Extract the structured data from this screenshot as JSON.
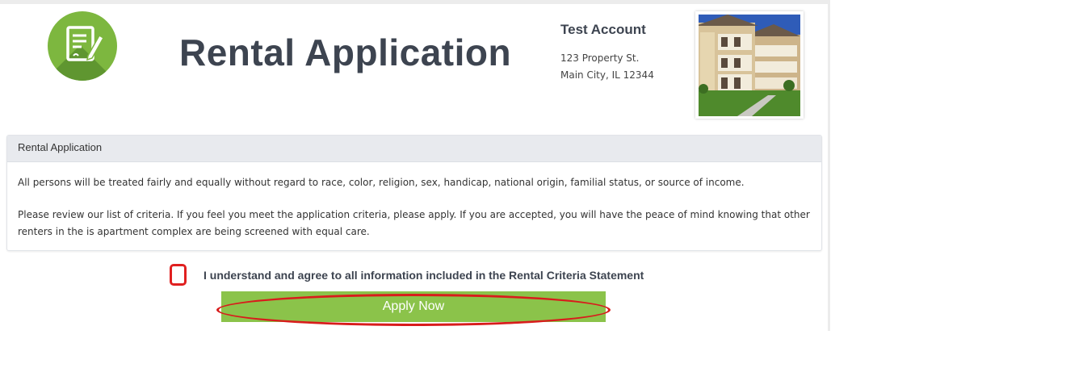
{
  "header": {
    "logo_icon": "application-form-icon",
    "title": "Rental Application"
  },
  "account": {
    "name": "Test Account",
    "address_line1": "123 Property St.",
    "address_line2": "Main City, IL 12344"
  },
  "property_photo": {
    "icon": "apartment-building-photo"
  },
  "panel": {
    "heading": "Rental Application",
    "paragraph1": "All persons will be treated fairly and equally without regard to race, color, religion, sex, handicap, national origin, familial status, or source of income.",
    "paragraph2": "Please review our list of criteria. If you feel you meet the application criteria, please apply. If you are accepted, you will have the peace of mind knowing that other renters in the is apartment complex are being screened with equal care."
  },
  "agreement": {
    "label": "I understand and agree to all information included in the Rental Criteria Statement",
    "checked": false
  },
  "actions": {
    "apply_label": "Apply Now"
  },
  "colors": {
    "accent_green": "#8bc34a",
    "logo_green": "#7db73f",
    "title_color": "#3d4450",
    "highlight_red": "#d81c1c"
  }
}
